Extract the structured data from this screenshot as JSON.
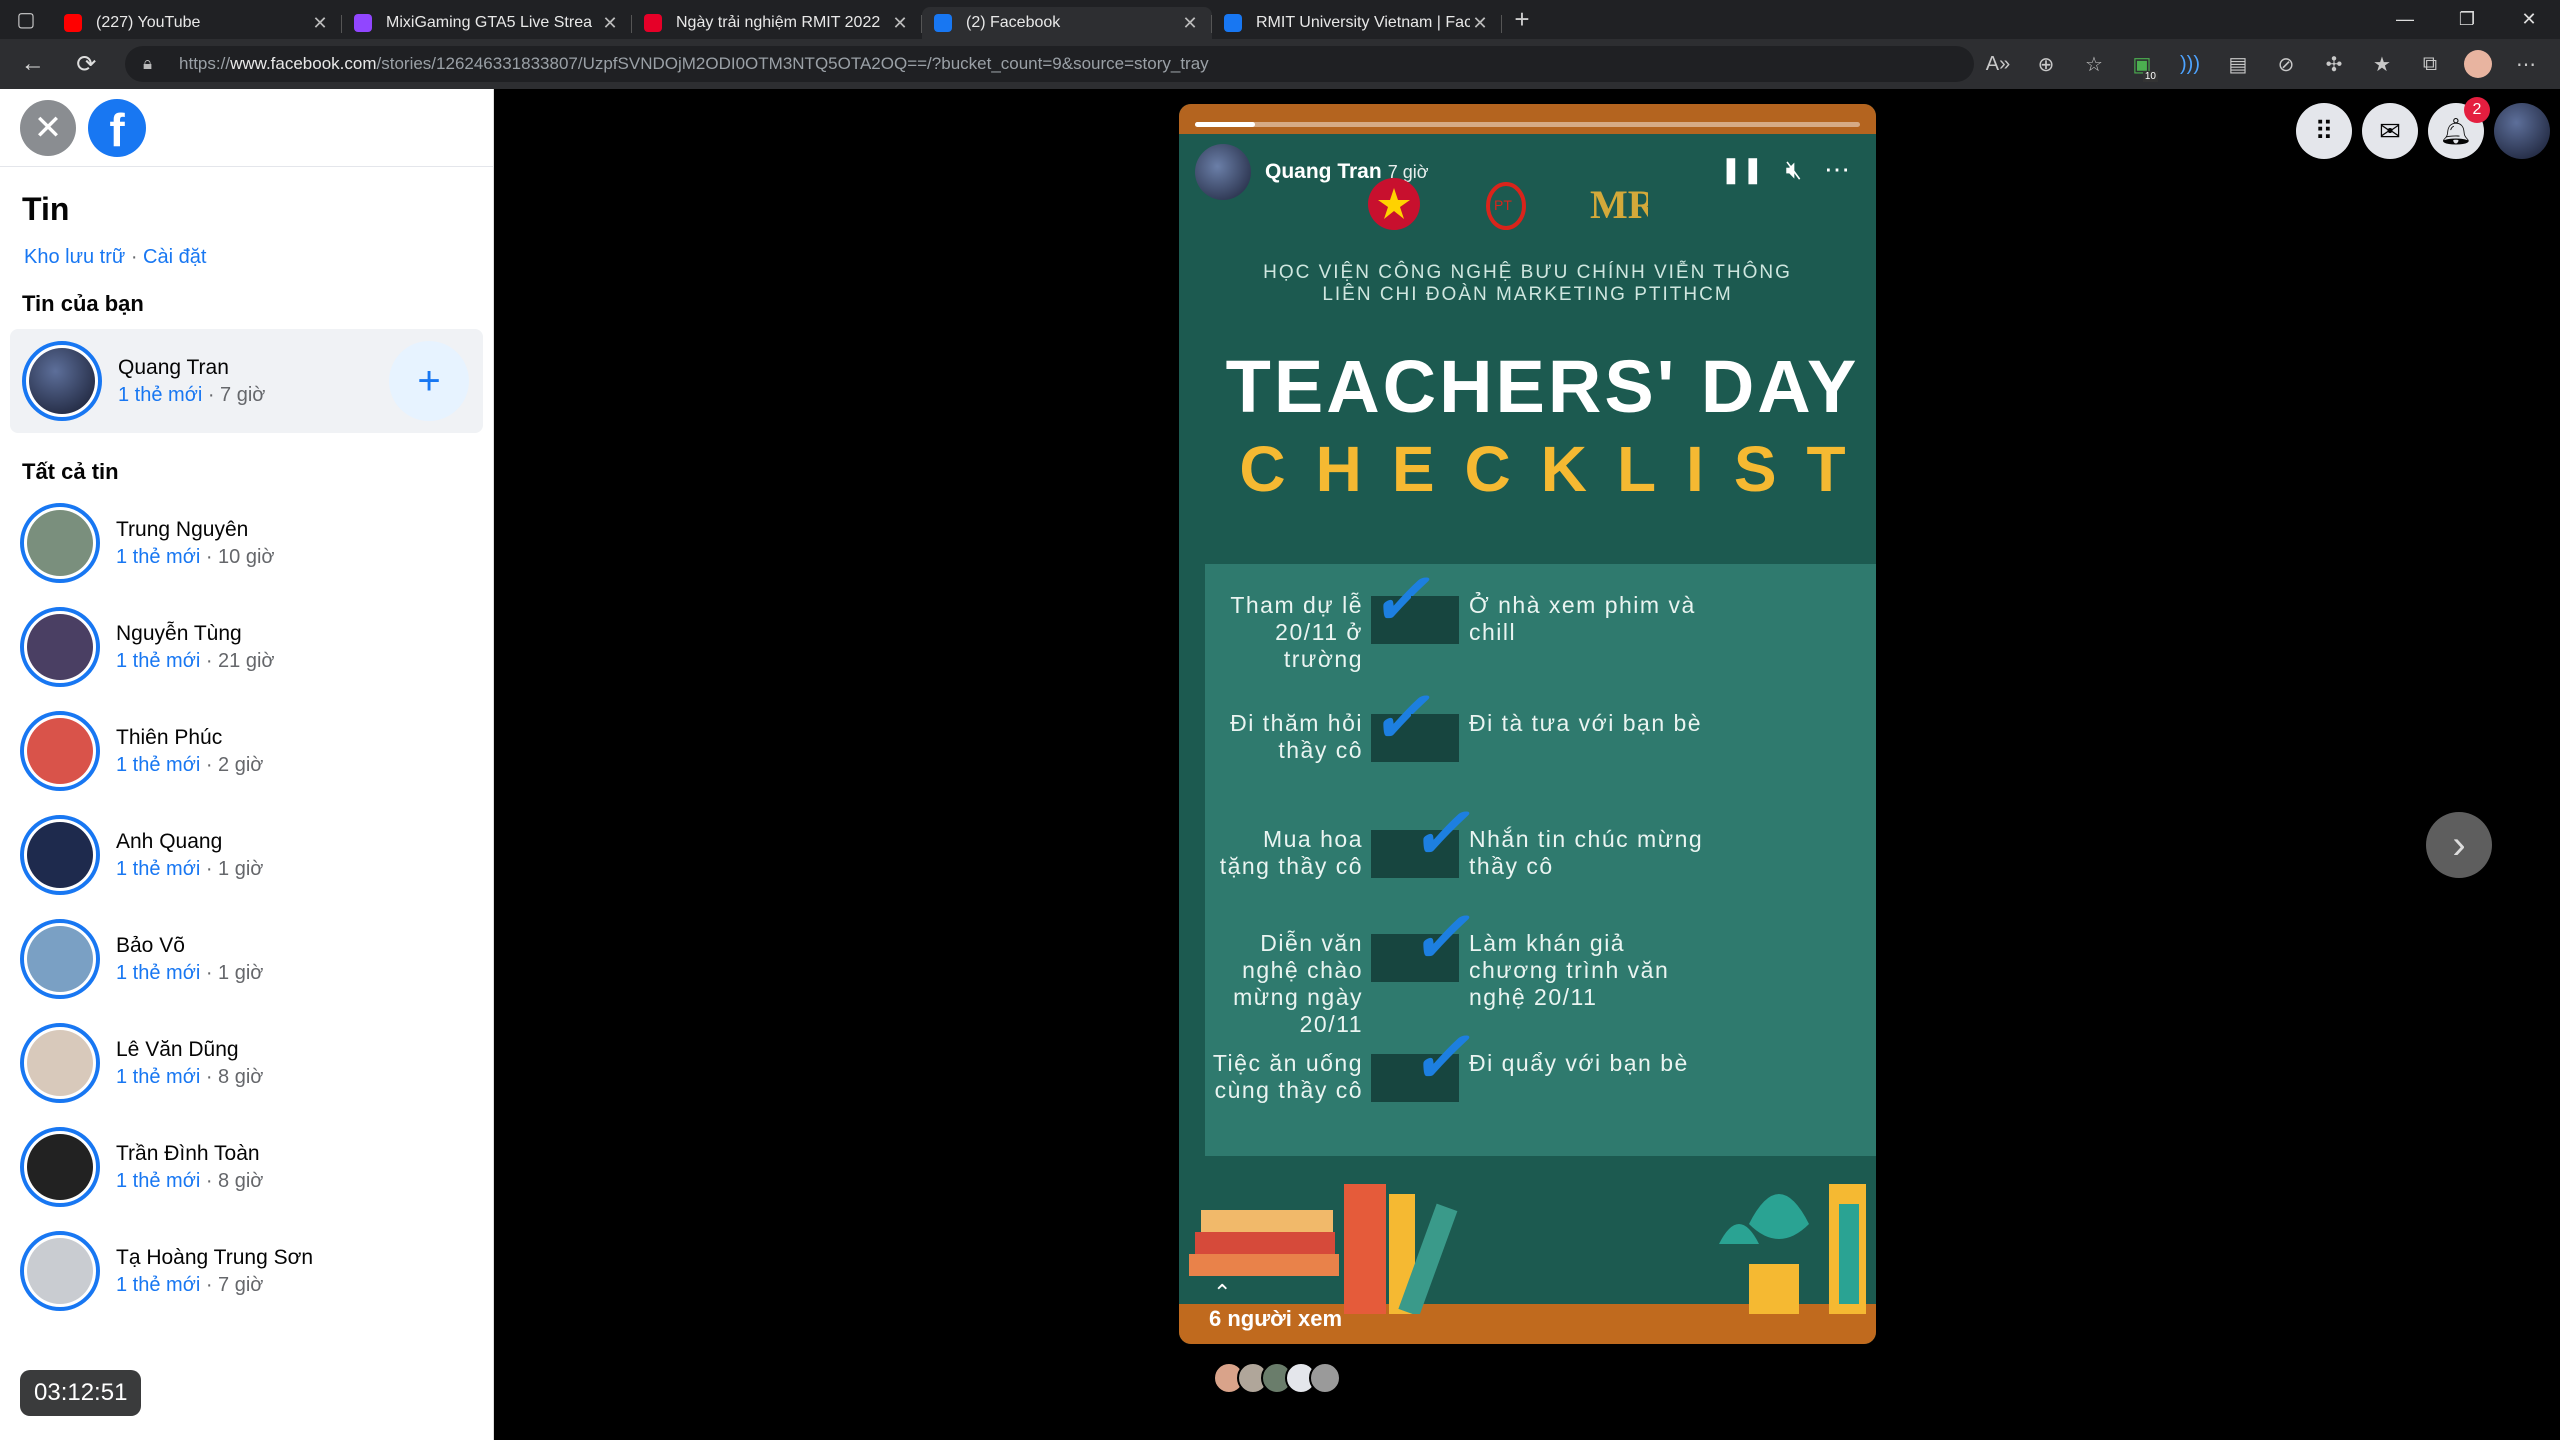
{
  "browser": {
    "tabs": [
      {
        "title": "(227) YouTube",
        "color": "#ff0000",
        "icon": "youtube-icon"
      },
      {
        "title": "MixiGaming GTA5 Live Strea",
        "color": "#9146ff",
        "icon": "twitch-icon"
      },
      {
        "title": "Ngày trải nghiệm RMIT 2022",
        "color": "#e60028",
        "icon": "rmit-icon"
      },
      {
        "title": "(2) Facebook",
        "color": "#1877f2",
        "icon": "facebook-icon"
      },
      {
        "title": "RMIT University Vietnam | Faceb",
        "color": "#1877f2",
        "icon": "facebook-icon"
      }
    ],
    "url_prefix": "https://",
    "url_host": "www.facebook.com",
    "url_path": "/stories/126246331833807/UzpfSVNDOjM2ODI0OTM3NTQ5OTA2OQ==/?bucket_count=9&source=story_tray",
    "ext_badge": "10"
  },
  "left": {
    "title": "Tin",
    "archive": "Kho lưu trữ",
    "settings": "Cài đặt",
    "your_stories": "Tin của bạn",
    "my_story": {
      "name": "Quang Tran",
      "new": "1 thẻ mới",
      "time": "7 giờ"
    },
    "all_stories": "Tất cả tin",
    "stories": [
      {
        "name": "Trung Nguyên",
        "new": "1 thẻ mới",
        "time": "10 giờ",
        "color": "#7a8f7d"
      },
      {
        "name": "Nguyễn Tùng",
        "new": "1 thẻ mới",
        "time": "21 giờ",
        "color": "#4a3f63"
      },
      {
        "name": "Thiên Phúc",
        "new": "1 thẻ mới",
        "time": "2 giờ",
        "color": "#d9534a"
      },
      {
        "name": "Anh Quang",
        "new": "1 thẻ mới",
        "time": "1 giờ",
        "color": "#1e2a4d"
      },
      {
        "name": "Bảo Võ",
        "new": "1 thẻ mới",
        "time": "1 giờ",
        "color": "#7aa0c4"
      },
      {
        "name": "Lê Văn Dũng",
        "new": "1 thẻ mới",
        "time": "8 giờ",
        "color": "#d8c9bb"
      },
      {
        "name": "Trần Đình Toàn",
        "new": "1 thẻ mới",
        "time": "8 giờ",
        "color": "#222222"
      },
      {
        "name": "Tạ Hoàng Trung Sơn",
        "new": "1 thẻ mới",
        "time": "7 giờ",
        "color": "#c9ccd1"
      }
    ],
    "timer": "03:12:51"
  },
  "story": {
    "owner": "Quang Tran",
    "time": "7 giờ",
    "progress": 0.09,
    "subtitle_line1": "HỌC VIỆN CÔNG NGHỆ BƯU CHÍNH VIỄN THÔNG",
    "subtitle_line2": "LIÊN CHI ĐOÀN MARKETING PTITHCM",
    "heading1": "TEACHERS' DAY",
    "heading2": "CHECKLIST",
    "left_items": [
      {
        "text": "Tham dự lễ 20/11 ở trường",
        "checked": true
      },
      {
        "text": "Đi thăm hỏi thầy cô",
        "checked": true
      },
      {
        "text": "Mua hoa tặng thầy cô",
        "checked": false
      },
      {
        "text": "Diễn văn nghệ chào mừng ngày 20/11",
        "checked": false
      },
      {
        "text": "Tiệc ăn uống cùng thầy cô",
        "checked": false
      }
    ],
    "right_items": [
      {
        "text": "Ở nhà xem phim và chill",
        "checked": false
      },
      {
        "text": "Đi tà tưa với bạn bè",
        "checked": false
      },
      {
        "text": "Nhắn tin chúc mừng thầy cô",
        "checked": true
      },
      {
        "text": "Làm khán giả chương trình văn nghệ 20/11",
        "checked": true
      },
      {
        "text": "Đi quẩy với bạn bè",
        "checked": true
      }
    ],
    "viewers": "6 người xem"
  },
  "topright": {
    "notif_count": "2"
  }
}
